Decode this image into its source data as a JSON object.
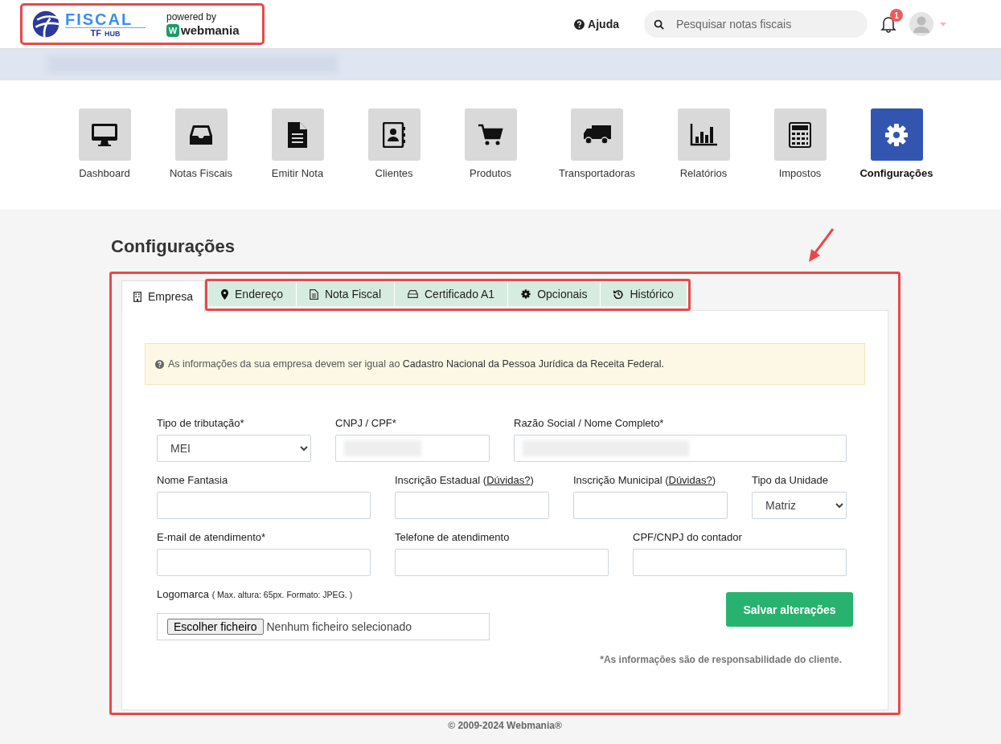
{
  "header": {
    "logo": {
      "title": "FISCAL",
      "sub_1": "TF",
      "sub_2": "HUB",
      "powered": "powered by",
      "brand_mark": "W",
      "brand": "webmania"
    },
    "help": "Ajuda",
    "search": {
      "placeholder": "Pesquisar notas fiscais"
    },
    "notification_count": "1"
  },
  "nav": [
    {
      "label": "Dashboard",
      "kind": "monitor",
      "selected": false
    },
    {
      "label": "Notas Fiscais",
      "kind": "inbox",
      "selected": false
    },
    {
      "label": "Emitir Nota",
      "kind": "document",
      "selected": false
    },
    {
      "label": "Clientes",
      "kind": "contacts",
      "selected": false
    },
    {
      "label": "Produtos",
      "kind": "cart",
      "selected": false
    },
    {
      "label": "Transportadoras",
      "kind": "truck",
      "selected": false
    },
    {
      "label": "Relatórios",
      "kind": "chart",
      "selected": false
    },
    {
      "label": "Impostos",
      "kind": "calculator",
      "selected": false
    },
    {
      "label": "Configurações",
      "kind": "gear",
      "selected": true
    }
  ],
  "page_title": "Configurações",
  "tabs": [
    {
      "label": "Empresa",
      "kind": "building",
      "selected": true
    },
    {
      "label": "Endereço",
      "kind": "pin",
      "selected": false
    },
    {
      "label": "Nota Fiscal",
      "kind": "file",
      "selected": false
    },
    {
      "label": "Certificado A1",
      "kind": "drive",
      "selected": false
    },
    {
      "label": "Opcionais",
      "kind": "gear",
      "selected": false
    },
    {
      "label": "Histórico",
      "kind": "history",
      "selected": false
    }
  ],
  "alert": {
    "text": "As informações da sua empresa devem ser igual ao",
    "emphasis": "Cadastro Nacional da Pessoa Jurídica da Receita Federal."
  },
  "form_rows": [
    [
      {
        "label": "Tipo de tributação*",
        "kind": "select",
        "value": "MEI"
      },
      {
        "label": "CNPJ / CPF*",
        "kind": "redacted"
      },
      {
        "label": "Razão Social / Nome Completo*",
        "kind": "redacted"
      }
    ],
    [
      {
        "label": "Nome Fantasia",
        "kind": "input"
      },
      {
        "label": "Inscrição Estadual (",
        "link": "Dúvidas?",
        "label_end": ")",
        "kind": "input"
      },
      {
        "label": "Inscrição Municipal (",
        "link": "Dúvidas?",
        "label_end": ")",
        "kind": "input"
      },
      {
        "label": "Tipo da Unidade",
        "kind": "select",
        "value": "Matriz"
      }
    ],
    [
      {
        "label": "E-mail de atendimento*",
        "kind": "input"
      },
      {
        "label": "Telefone de atendimento",
        "kind": "input"
      },
      {
        "label": "CPF/CNPJ do contador",
        "kind": "input"
      }
    ]
  ],
  "logo_field": {
    "label": "Logomarca",
    "hint": "( Max. altura: 65px. Formato: JPEG. )",
    "button": "Escolher ficheiro",
    "status": "Nenhum ficheiro selecionado"
  },
  "save_button": "Salvar alterações",
  "disclaimer": "*As informações são de responsabilidade do cliente.",
  "footer": "© 2009-2024 Webmania®"
}
